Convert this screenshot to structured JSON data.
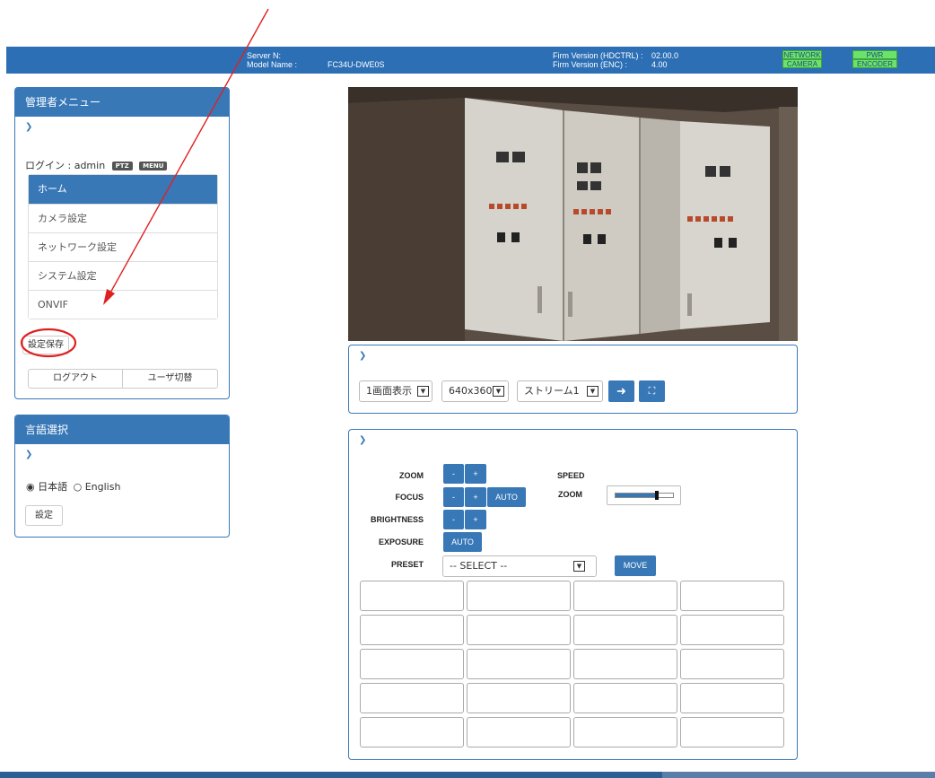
{
  "header": {
    "server_name_label": "Server N:",
    "model_name_label": "Model Name :",
    "model_name_value": "FC34U-DWE0S",
    "firm_hdctrl_label": "Firm Version (HDCTRL) :",
    "firm_hdctrl_value": "02.00.0",
    "firm_enc_label": "Firm Version (ENC) :",
    "firm_enc_value": "4.00",
    "badges": [
      "NETWORK",
      "CAMERA",
      "PWR",
      "ENCODER"
    ]
  },
  "admin_panel": {
    "title": "管理者メニュー",
    "login_text": "ログイン : admin",
    "tag_ptz": "PTZ",
    "tag_menu": "MENU",
    "menu_items": [
      "ホーム",
      "カメラ設定",
      "ネットワーク設定",
      "システム設定",
      "ONVIF"
    ],
    "save_label": "設定保存",
    "logout_label": "ログアウト",
    "switch_user_label": "ユーザ切替"
  },
  "language_panel": {
    "title": "言語選択",
    "option_ja": "日本語",
    "option_en": "English",
    "selected": "日本語",
    "set_label": "設定"
  },
  "video_controls": {
    "layout_select": "1画面表示",
    "resolution_select": "640x360",
    "stream_select": "ストリーム1"
  },
  "ptz_panel": {
    "zoom_label": "ZOOM",
    "focus_label": "FOCUS",
    "brightness_label": "BRIGHTNESS",
    "exposure_label": "EXPOSURE",
    "preset_label": "PRESET",
    "speed_label": "SPEED",
    "speed_zoom_label": "ZOOM",
    "minus": "-",
    "plus": "+",
    "auto_label": "AUTO",
    "preset_placeholder": "-- SELECT --",
    "move_label": "MOVE"
  },
  "colors": {
    "header_blue": "#2c6fb5",
    "panel_blue": "#3878b7",
    "badge_green": "#6be36b",
    "annotation_red": "#e02020"
  }
}
